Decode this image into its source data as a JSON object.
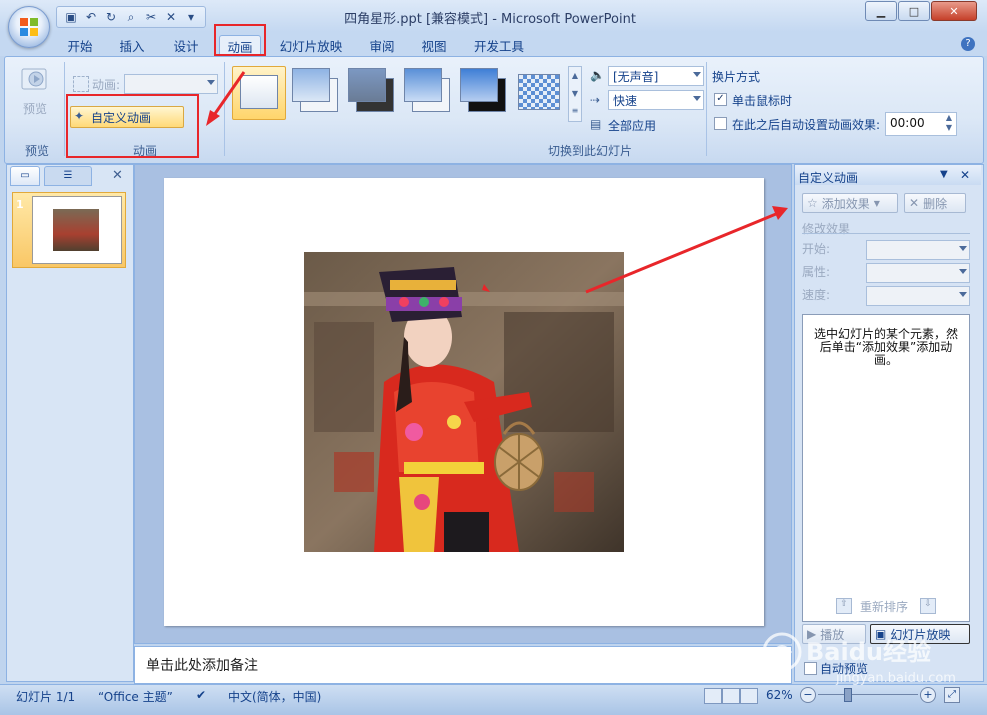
{
  "window": {
    "title": "四角星形.ppt [兼容模式] - Microsoft PowerPoint"
  },
  "ribbon_tabs": [
    "开始",
    "插入",
    "设计",
    "动画",
    "幻灯片放映",
    "审阅",
    "视图",
    "开发工具"
  ],
  "active_tab": "动画",
  "ribbon": {
    "preview_group": {
      "button_label": "预览",
      "group_label": "预览"
    },
    "animation_group": {
      "animate_label": "动画:",
      "custom_animation_button": "自定义动画",
      "group_label": "动画"
    },
    "transition_group": {
      "sound_value": "[无声音]",
      "speed_value": "快速",
      "apply_all_label": "全部应用",
      "group_label": "切换到此幻灯片"
    },
    "advance_group": {
      "title": "换片方式",
      "on_click_label": "单击鼠标时",
      "on_click_checked": true,
      "auto_after_label": "在此之后自动设置动画效果:",
      "auto_after_checked": false,
      "auto_after_value": "00:00"
    }
  },
  "slides_pane": {
    "slide_number": "1"
  },
  "notes": {
    "placeholder": "单击此处添加备注"
  },
  "task_pane": {
    "title": "自定义动画",
    "add_effect_label": "添加效果",
    "remove_label": "删除",
    "modify_label": "修改效果",
    "start_label": "开始:",
    "property_label": "属性:",
    "speed_label": "速度:",
    "hint_text": "选中幻灯片的某个元素，然后单击“添加效果”添加动画。",
    "reorder_label": "重新排序",
    "play_label": "播放",
    "slideshow_label": "幻灯片放映",
    "auto_preview_label": "自动预览"
  },
  "status_bar": {
    "slide_info": "幻灯片 1/1",
    "theme": "“Office 主题”",
    "language": "中文(简体，中国)",
    "zoom": "62%"
  },
  "colors": {
    "annotation_red": "#e8262a",
    "ribbon_blue": "#dbe7f6",
    "text_blue": "#15428b"
  },
  "watermark": {
    "brand": "Baidu经验",
    "url": "jingyan.baidu.com"
  }
}
